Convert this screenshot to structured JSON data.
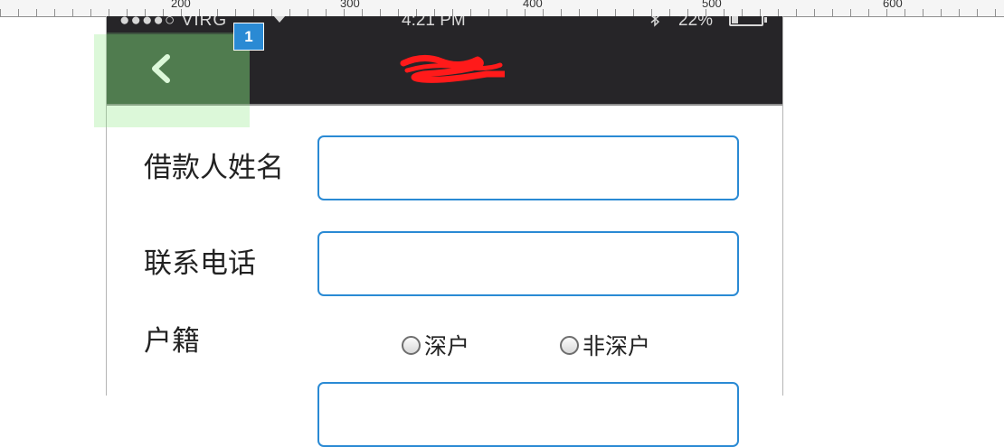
{
  "ruler": {
    "labels": [
      "200",
      "300",
      "400",
      "500",
      "600"
    ]
  },
  "status_bar": {
    "carrier": "VIRG",
    "signal": "●●●●○",
    "time": "4:21 PM",
    "battery_text": "22%",
    "battery_level": 0.22
  },
  "nav": {
    "back_glyph": "<",
    "highlight_badge": "1"
  },
  "form": {
    "borrower_name_label": "借款人姓名",
    "borrower_name_value": "",
    "phone_label": "联系电话",
    "phone_value": "",
    "household_label": "户籍",
    "household_options": [
      "深户",
      "非深户"
    ]
  },
  "colors": {
    "navbar": "#262528",
    "back_highlight": "#3e5440",
    "input_border": "#2a8ad4",
    "title_scribble": "#ff1a1a"
  }
}
